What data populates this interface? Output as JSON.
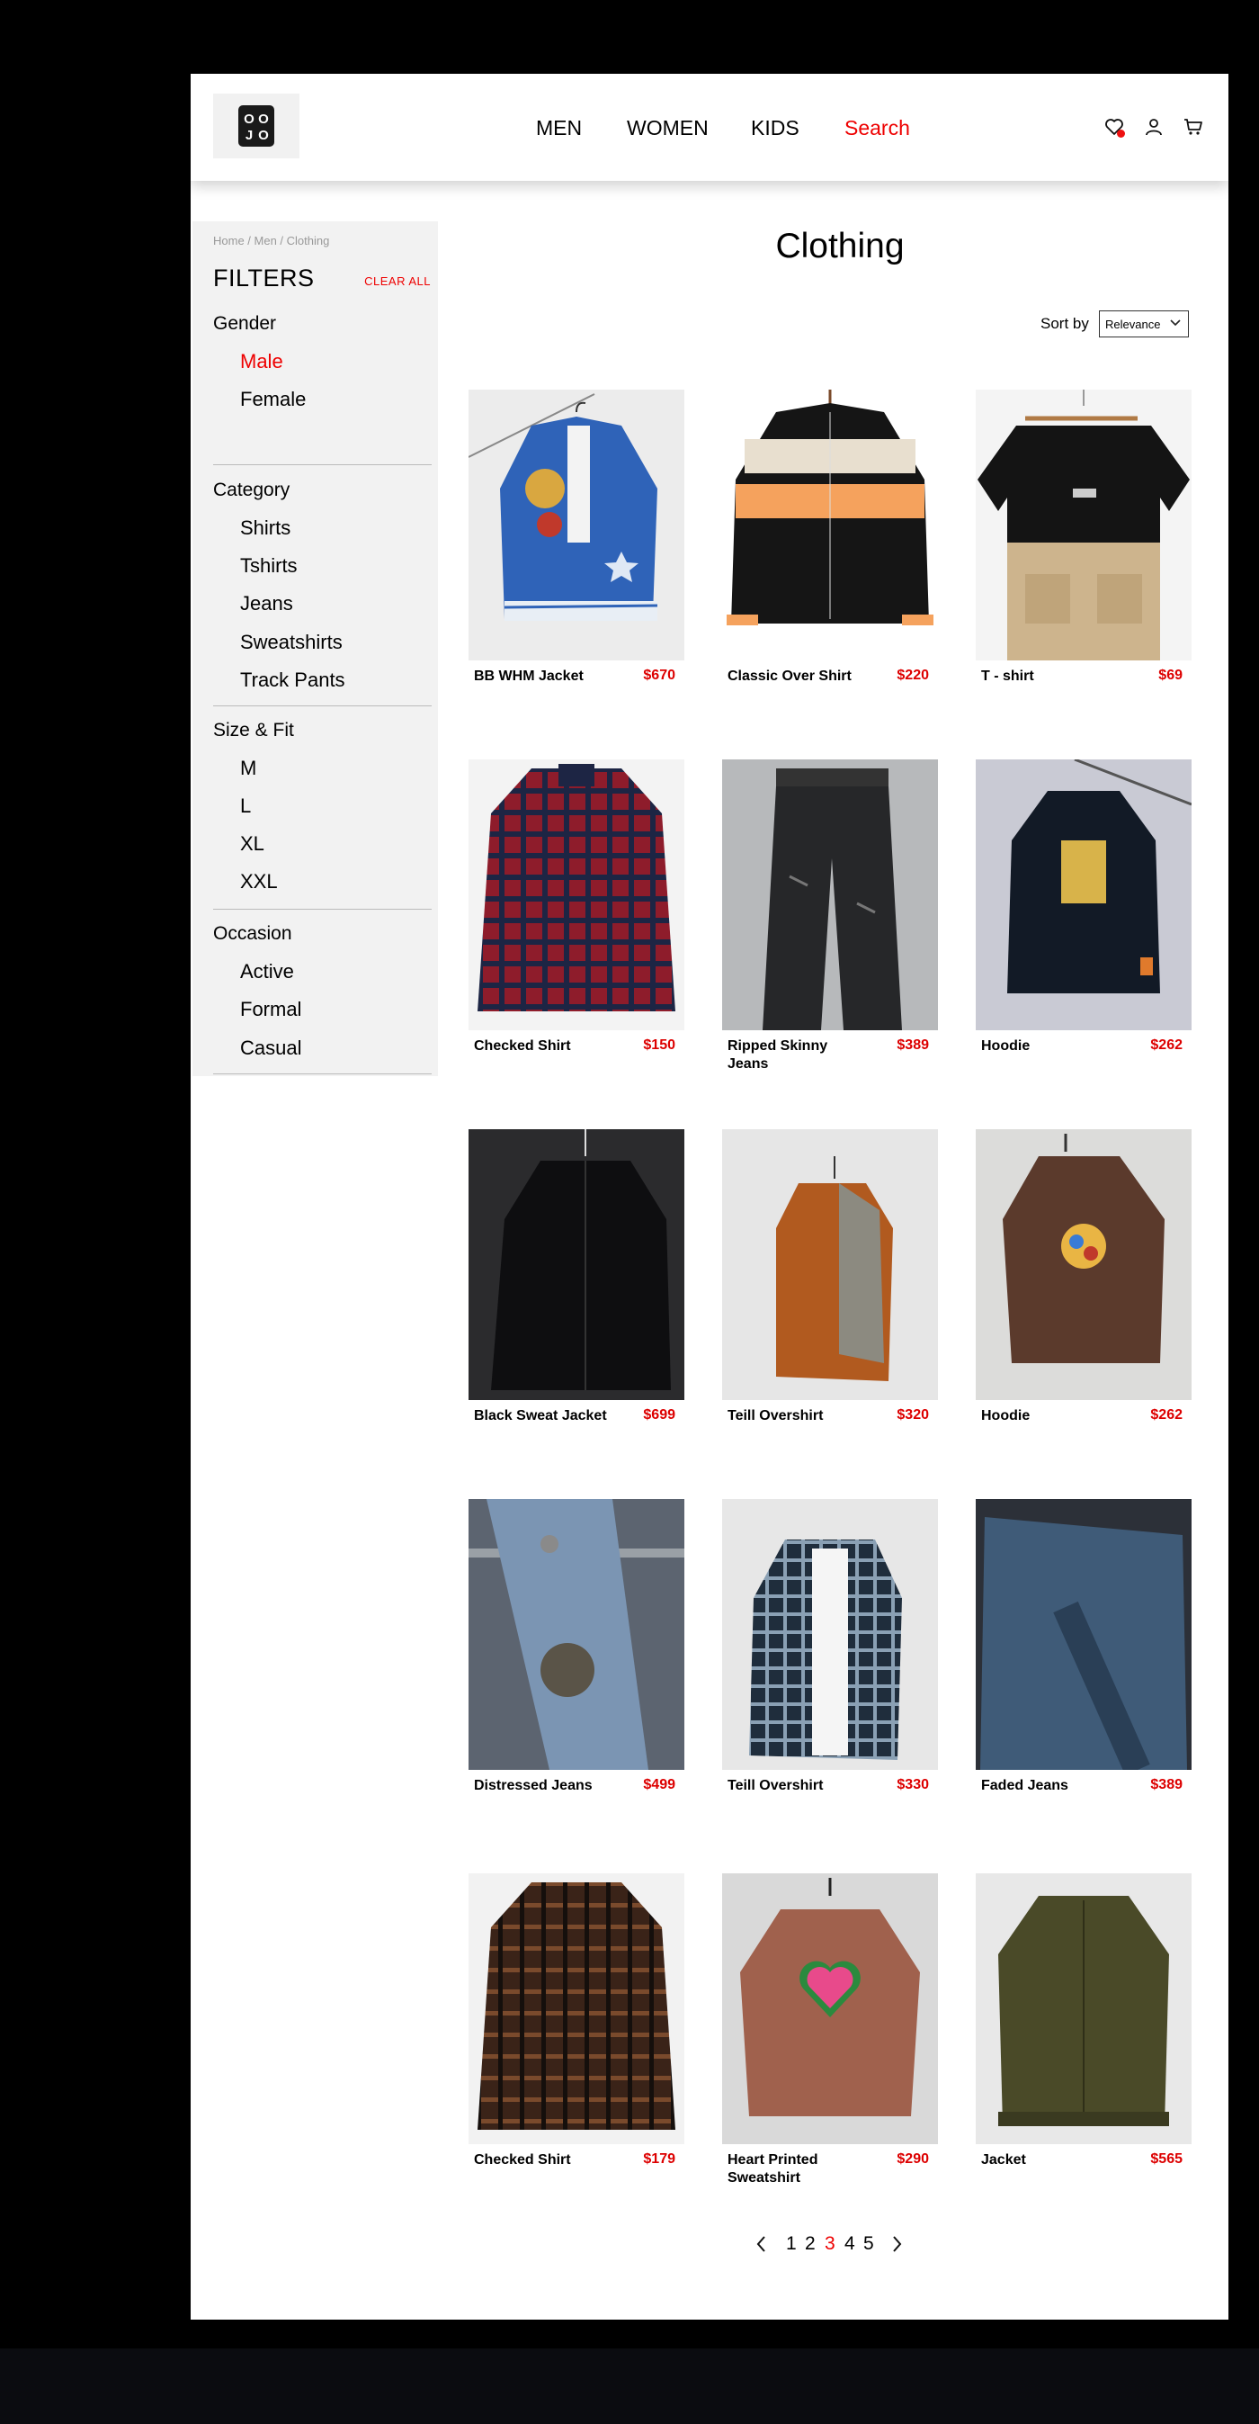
{
  "header": {
    "logo_letters": [
      "O",
      "O",
      "J",
      "O"
    ],
    "nav": [
      {
        "label": "MEN",
        "accent": false
      },
      {
        "label": "WOMEN",
        "accent": false
      },
      {
        "label": "KIDS",
        "accent": false
      },
      {
        "label": "Search",
        "accent": true
      }
    ],
    "icons": [
      "heart-icon",
      "user-icon",
      "cart-icon"
    ]
  },
  "sidebar": {
    "breadcrumb": "Home / Men / Clothing",
    "title": "FILTERS",
    "clear_all": "CLEAR ALL",
    "groups": [
      {
        "title": "Gender",
        "options": [
          "Male",
          "Female"
        ]
      },
      {
        "title": "Category",
        "options": [
          "Shirts",
          "Tshirts",
          "Jeans",
          "Sweatshirts",
          "Track Pants"
        ]
      },
      {
        "title": "Size & Fit",
        "options": [
          "M",
          "L",
          "XL",
          "XXL"
        ]
      },
      {
        "title": "Occasion",
        "options": [
          "Active",
          "Formal",
          "Casual"
        ]
      }
    ],
    "selected_option": "Male"
  },
  "main": {
    "title": "Clothing",
    "sort_label": "Sort by",
    "sort_value": "Relevance",
    "products": [
      {
        "name": "BB WHM Jacket",
        "price": "$670"
      },
      {
        "name": "Classic Over Shirt",
        "price": "$220"
      },
      {
        "name": "T - shirt",
        "price": "$69"
      },
      {
        "name": "Checked Shirt",
        "price": "$150"
      },
      {
        "name": "Ripped Skinny Jeans",
        "price": "$389"
      },
      {
        "name": "Hoodie",
        "price": "$262"
      },
      {
        "name": "Black Sweat Jacket",
        "price": "$699"
      },
      {
        "name": "Teill Overshirt",
        "price": "$320"
      },
      {
        "name": "Hoodie",
        "price": "$262"
      },
      {
        "name": "Distressed Jeans",
        "price": "$499"
      },
      {
        "name": "Teill Overshirt",
        "price": "$330"
      },
      {
        "name": "Faded Jeans",
        "price": "$389"
      },
      {
        "name": "Checked Shirt",
        "price": "$179"
      },
      {
        "name": "Heart Printed Sweatshirt",
        "price": "$290"
      },
      {
        "name": "Jacket",
        "price": "$565"
      }
    ],
    "pagination": {
      "pages": [
        "1",
        "2",
        "3",
        "4",
        "5"
      ],
      "current": "3"
    }
  },
  "colors": {
    "accent": "#e00000",
    "sidebar_bg": "#f2f2f2",
    "page_bg": "#ffffff",
    "frame_bg": "#000000"
  }
}
